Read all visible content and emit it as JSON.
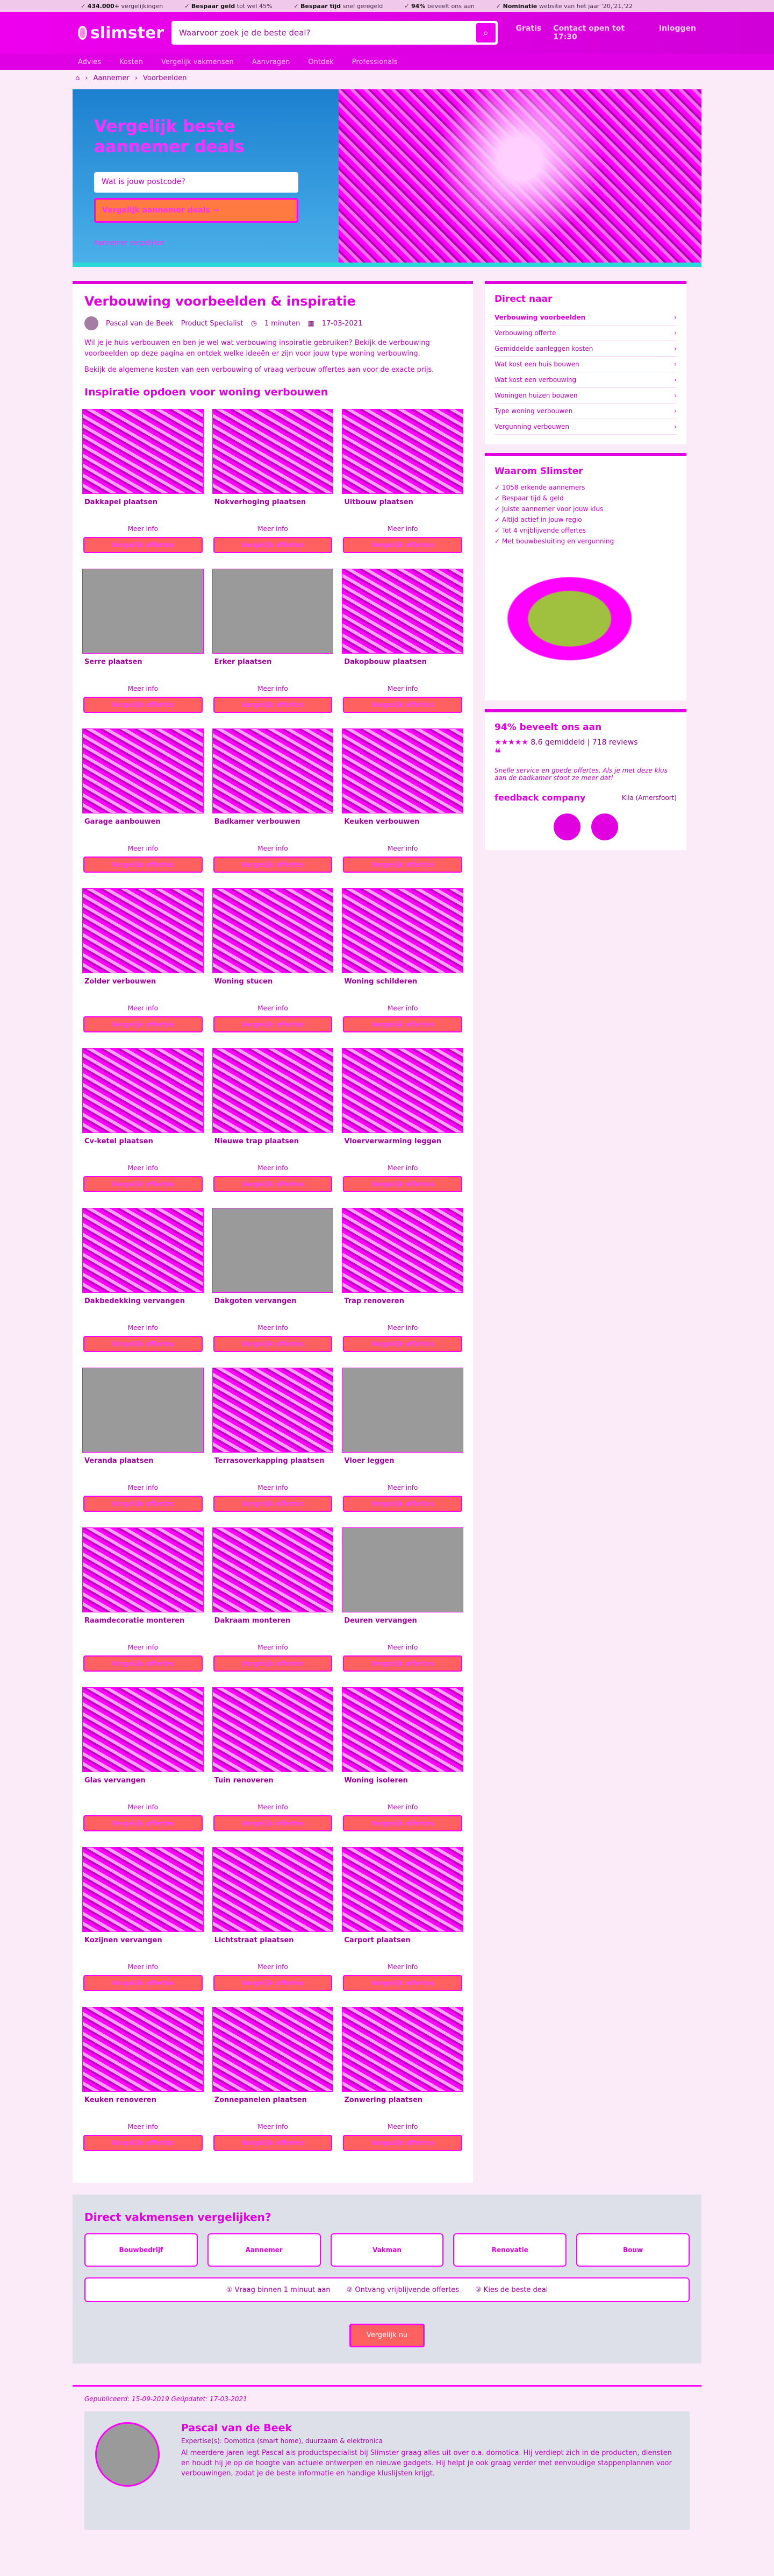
{
  "topbar": {
    "items": [
      {
        "b": "434.000+",
        "t": "vergelijkingen"
      },
      {
        "b": "Bespaar geld",
        "t": "tot wel 45%"
      },
      {
        "b": "Bespaar tijd",
        "t": "snel geregeld"
      },
      {
        "b": "94%",
        "t": "beveelt ons aan"
      },
      {
        "b": "Nominatie",
        "t": "website van het jaar '20,'21,'22"
      }
    ]
  },
  "header": {
    "logo": "slimster",
    "search_placeholder": "Waarvoor zoek je de beste deal?",
    "links": [
      "Gratis",
      "Contact open tot 17:30",
      "Inloggen"
    ]
  },
  "nav": [
    "Advies",
    "Kosten",
    "Vergelijk vakmensen",
    "Aanvragen",
    "Ontdek",
    "Professionals"
  ],
  "breadcrumb": [
    "Aannemer",
    "Voorbeelden"
  ],
  "hero": {
    "title": "Vergelijk beste aannemer deals",
    "input": "Wat is jouw postcode?",
    "button": "Vergelijk aannemer deals →",
    "note": "Aannemer vergelijken"
  },
  "article": {
    "title": "Verbouwing voorbeelden & inspiratie",
    "author": "Pascal van de Beek",
    "role": "Product Specialist",
    "read": "1 minuten",
    "date": "17-03-2021",
    "intro1": "Wil je je huis verbouwen en ben je wel wat verbouwing inspiratie gebruiken? Bekijk de verbouwing voorbeelden op deze pagina en ontdek welke ideeën er zijn voor jouw type woning verbouwing.",
    "intro2": "Bekijk de algemene kosten van een verbouwing of vraag verbouw offertes aan voor de exacte prijs.",
    "subtitle": "Inspiratie opdoen voor woning verbouwen",
    "more_label": "Meer info",
    "btn_label": "Vergelijk offertes",
    "cards": [
      "Dakkapel plaatsen",
      "Nokverhoging plaatsen",
      "Uitbouw plaatsen",
      "Serre plaatsen",
      "Erker plaatsen",
      "Dakopbouw plaatsen",
      "Garage aanbouwen",
      "Badkamer verbouwen",
      "Keuken verbouwen",
      "Zolder verbouwen",
      "Woning stucen",
      "Woning schilderen",
      "Cv-ketel plaatsen",
      "Nieuwe trap plaatsen",
      "Vloerverwarming leggen",
      "Dakbedekking vervangen",
      "Dakgoten vervangen",
      "Trap renoveren",
      "Veranda plaatsen",
      "Terrasoverkapping plaatsen",
      "Vloer leggen",
      "Raamdecoratie monteren",
      "Dakraam monteren",
      "Deuren vervangen",
      "Glas vervangen",
      "Tuin renoveren",
      "Woning isoleren",
      "Kozijnen vervangen",
      "Lichtstraat plaatsen",
      "Carport plaatsen",
      "Keuken renoveren",
      "Zonnepanelen plaatsen",
      "Zonwering plaatsen"
    ],
    "grey": [
      3,
      4,
      16,
      18,
      20,
      23
    ]
  },
  "side": {
    "direct_title": "Direct naar",
    "direct": [
      "Verbouwing voorbeelden",
      "Verbouwing offerte",
      "Gemiddelde aanleggen kosten",
      "Wat kost een huis bouwen",
      "Wat kost een verbouwing",
      "Woningen huizen bouwen",
      "Type woning verbouwen",
      "Vergunning verbouwen"
    ],
    "why_title": "Waarom Slimster",
    "why": [
      "✓ 1058 erkende aannemers",
      "✓ Bespaar tijd & geld",
      "✓ Juiste aannemer voor jouw klus",
      "✓ Altijd actief in jouw regio",
      "✓ Tot 4 vrijblijvende offertes",
      "✓ Met bouwbesluiting en vergunning"
    ],
    "rec_title": "94% beveelt ons aan",
    "rating": "8.6 gemiddeld",
    "reviews": "718 reviews",
    "quote": "Snelle service en goede offertes. Als je met deze klus aan de badkamer stoot ze meer dat!",
    "reviewer": "Kila (Amersfoort)",
    "feedback": "feedback company"
  },
  "vak": {
    "title": "Direct vakmensen vergelijken?",
    "logos": [
      "Bouwbedrijf",
      "Aannemer",
      "Vakman",
      "Renovatie",
      "Bouw"
    ],
    "steps": [
      "Vraag binnen 1 minuut aan",
      "Ontvang vrijblijvende offertes",
      "Kies de beste deal"
    ],
    "button": "Vergelijk nu"
  },
  "about": {
    "dates": "Gepubliceerd: 15-09-2019 Geüpdatet: 17-03-2021",
    "name": "Pascal van de Beek",
    "exp": "Expertise(s): Domotica (smart home), duurzaam & elektronica",
    "bio": "Al meerdere jaren legt Pascal als productspecialist bij Slimster graag alles uit over o.a. domotica. Hij verdiept zich in de producten, diensten en houdt hij je op de hoogte van actuele ontwerpen en nieuwe gadgets. Hij helpt je ook graag verder met eenvoudige stappenplannen voor verbouwingen, zodat je de beste informatie en handige kluslijsten krijgt."
  }
}
